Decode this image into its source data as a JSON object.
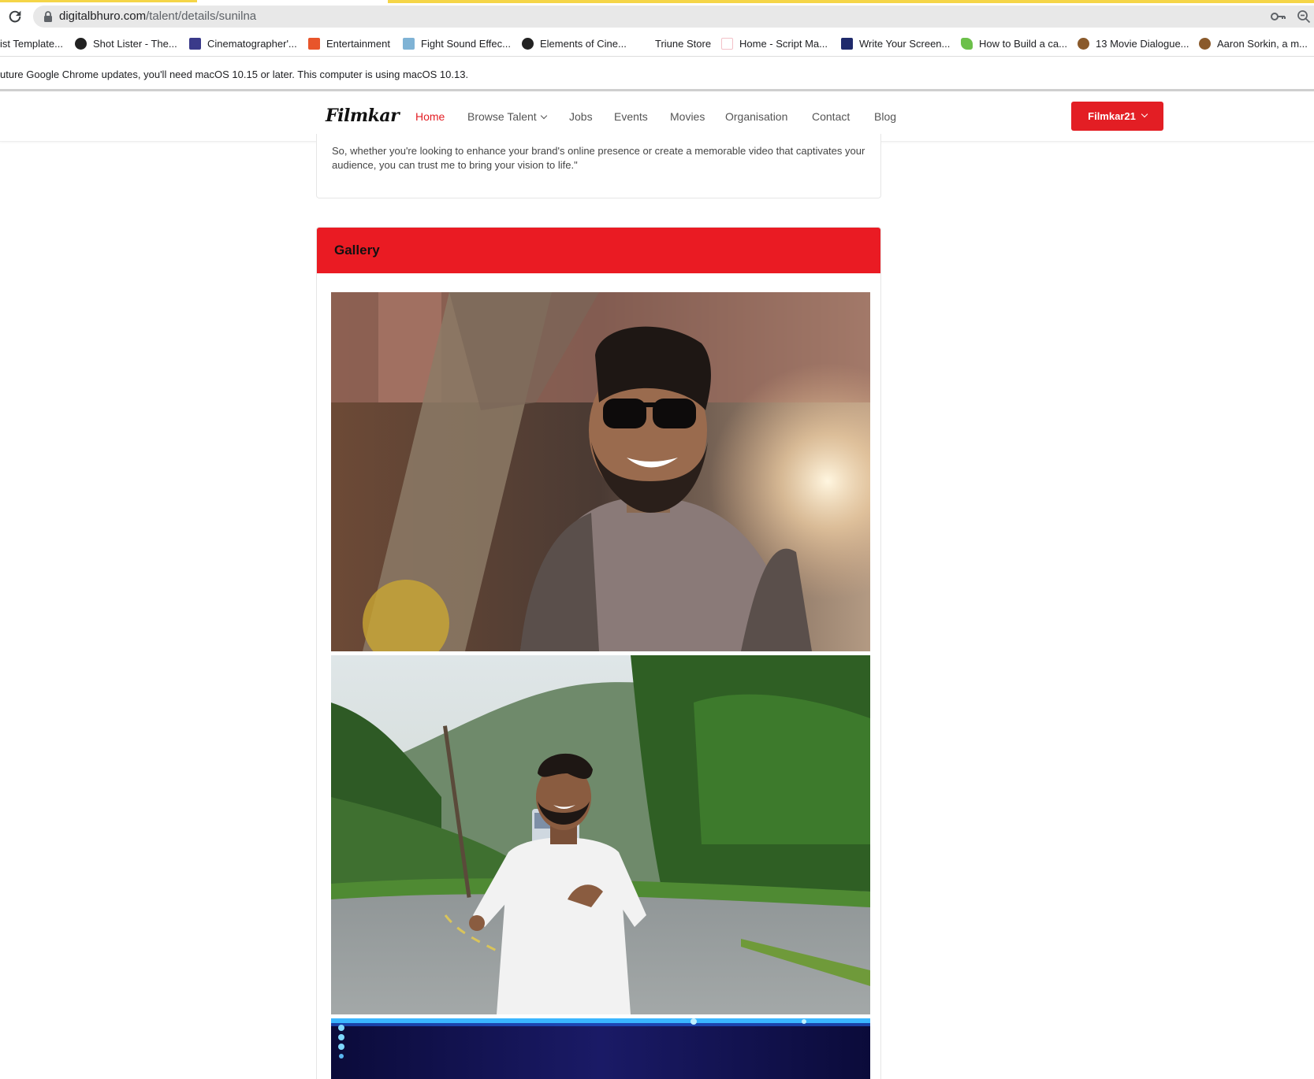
{
  "browser": {
    "url_host": "digitalbhuro.com",
    "url_path": "/talent/details/sunilna",
    "bookmarks": [
      {
        "label": "ist Template...",
        "color": "#ffffff"
      },
      {
        "label": "Shot Lister - The...",
        "color": "#222222"
      },
      {
        "label": "Cinematographer'...",
        "color": "#3a3a8a"
      },
      {
        "label": "Entertainment",
        "color": "#e8552b"
      },
      {
        "label": "Fight Sound Effec...",
        "color": "#7fb3d5"
      },
      {
        "label": "Elements of Cine...",
        "color": "#222222"
      },
      {
        "label": "Triune Store",
        "color": "#ffffff"
      },
      {
        "label": "Home - Script Ma...",
        "color": "#e84a5f"
      },
      {
        "label": "Write Your Screen...",
        "color": "#1f2a6b"
      },
      {
        "label": "How to Build a ca...",
        "color": "#6cc04a"
      },
      {
        "label": "13 Movie Dialogue...",
        "color": "#8a5a2b"
      },
      {
        "label": "Aaron Sorkin, a m...",
        "color": "#8a5a2b"
      }
    ],
    "infobar_text": "uture Google Chrome updates, you'll need macOS 10.15 or later. This computer is using macOS 10.13."
  },
  "site": {
    "logo": "Filmkar",
    "nav": {
      "home": "Home",
      "browse_talent": "Browse Talent",
      "jobs": "Jobs",
      "events": "Events",
      "movies": "Movies",
      "organisation": "Organisation",
      "contact": "Contact",
      "blog": "Blog"
    },
    "user_button": "Filmkar21",
    "accent_color": "#e31e24"
  },
  "content": {
    "about_text": "So, whether you're looking to enhance your brand's online presence or create a memorable video that captivates your audience, you can trust me to bring your vision to life.\"",
    "gallery_title": "Gallery"
  }
}
